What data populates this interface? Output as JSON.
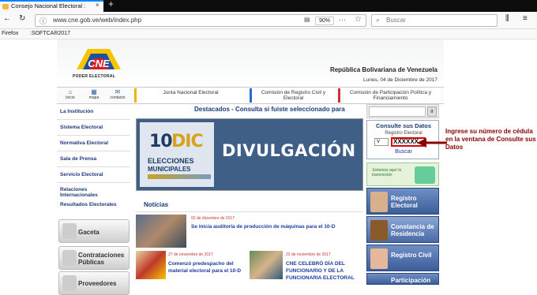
{
  "browser": {
    "tab_title": "Consejo Nacional Electoral : ",
    "tab_close": "×",
    "new_tab": "+",
    "url": "www.cne.gob.ve/web/index.php",
    "zoom": "90%",
    "search_placeholder": "Buscar",
    "bookmarks": [
      "Firefox",
      ":SOFTCAR2017"
    ]
  },
  "header": {
    "logo_text": "CNE",
    "logo_sub": "PODER ELECTORAL",
    "country": "República Bolivariana de Venezuela",
    "date": "Lunes, 04 de Diciembre de 2017"
  },
  "quick_icons": [
    {
      "label": "inicio",
      "glyph": "⌂"
    },
    {
      "label": "mapa",
      "glyph": "▦"
    },
    {
      "label": "contacto",
      "glyph": "✉"
    }
  ],
  "top_nav": [
    {
      "label": "Junta Nacional Electoral",
      "color": "#f0b400"
    },
    {
      "label": "Comisión de Registro Civil y Electoral",
      "color": "#3366cc"
    },
    {
      "label": "Comisión de Participación Política y Financiamiento",
      "color": "#cc3333"
    }
  ],
  "left_nav": [
    "La Institución",
    "Sistema Electoral",
    "Normativa Electoral",
    "Sala de Prensa",
    "Servicio Electoral",
    "Relaciones Internacionales",
    "Resultados Electorales"
  ],
  "big_buttons": [
    "Gaceta",
    "Contrataciones Públicas",
    "Proveedores"
  ],
  "featured": "Destacados - Consulta si fuiste seleccionado para",
  "banner": {
    "number": "10",
    "month": "DIC",
    "line1": "ELECCIONES",
    "line2": "MUNICIPALES",
    "title": "DIVULGACIÓN"
  },
  "news_heading": "Noticias",
  "news": [
    {
      "date": "02 de diciembre de 2017",
      "title": "Se inicia auditoría de producción de máquinas para el 10-D"
    },
    {
      "date": "27 de noviembre de 2017",
      "title": "Comenzó predespacho del material electoral para el 10-D"
    },
    {
      "date": "22 de noviembre de 2017",
      "title": "CNE CELEBRÓ DÍA DEL FUNCIONARIO Y DE LA FUNCIONARIA ELECTORAL"
    }
  ],
  "consult": {
    "title": "Consulte sus Datos",
    "label": "Registro Electoral",
    "select": "V",
    "value": "XXXXXX",
    "button": "Buscar"
  },
  "sintonize": "Sintoniza aquí la transmisión",
  "right_buttons": [
    "Registro Electoral",
    "Constancia de Residencia",
    "Registro Civil",
    "Participación"
  ],
  "annotation": "Ingrese su número de cédula en la ventana de Consulte sus Datos"
}
